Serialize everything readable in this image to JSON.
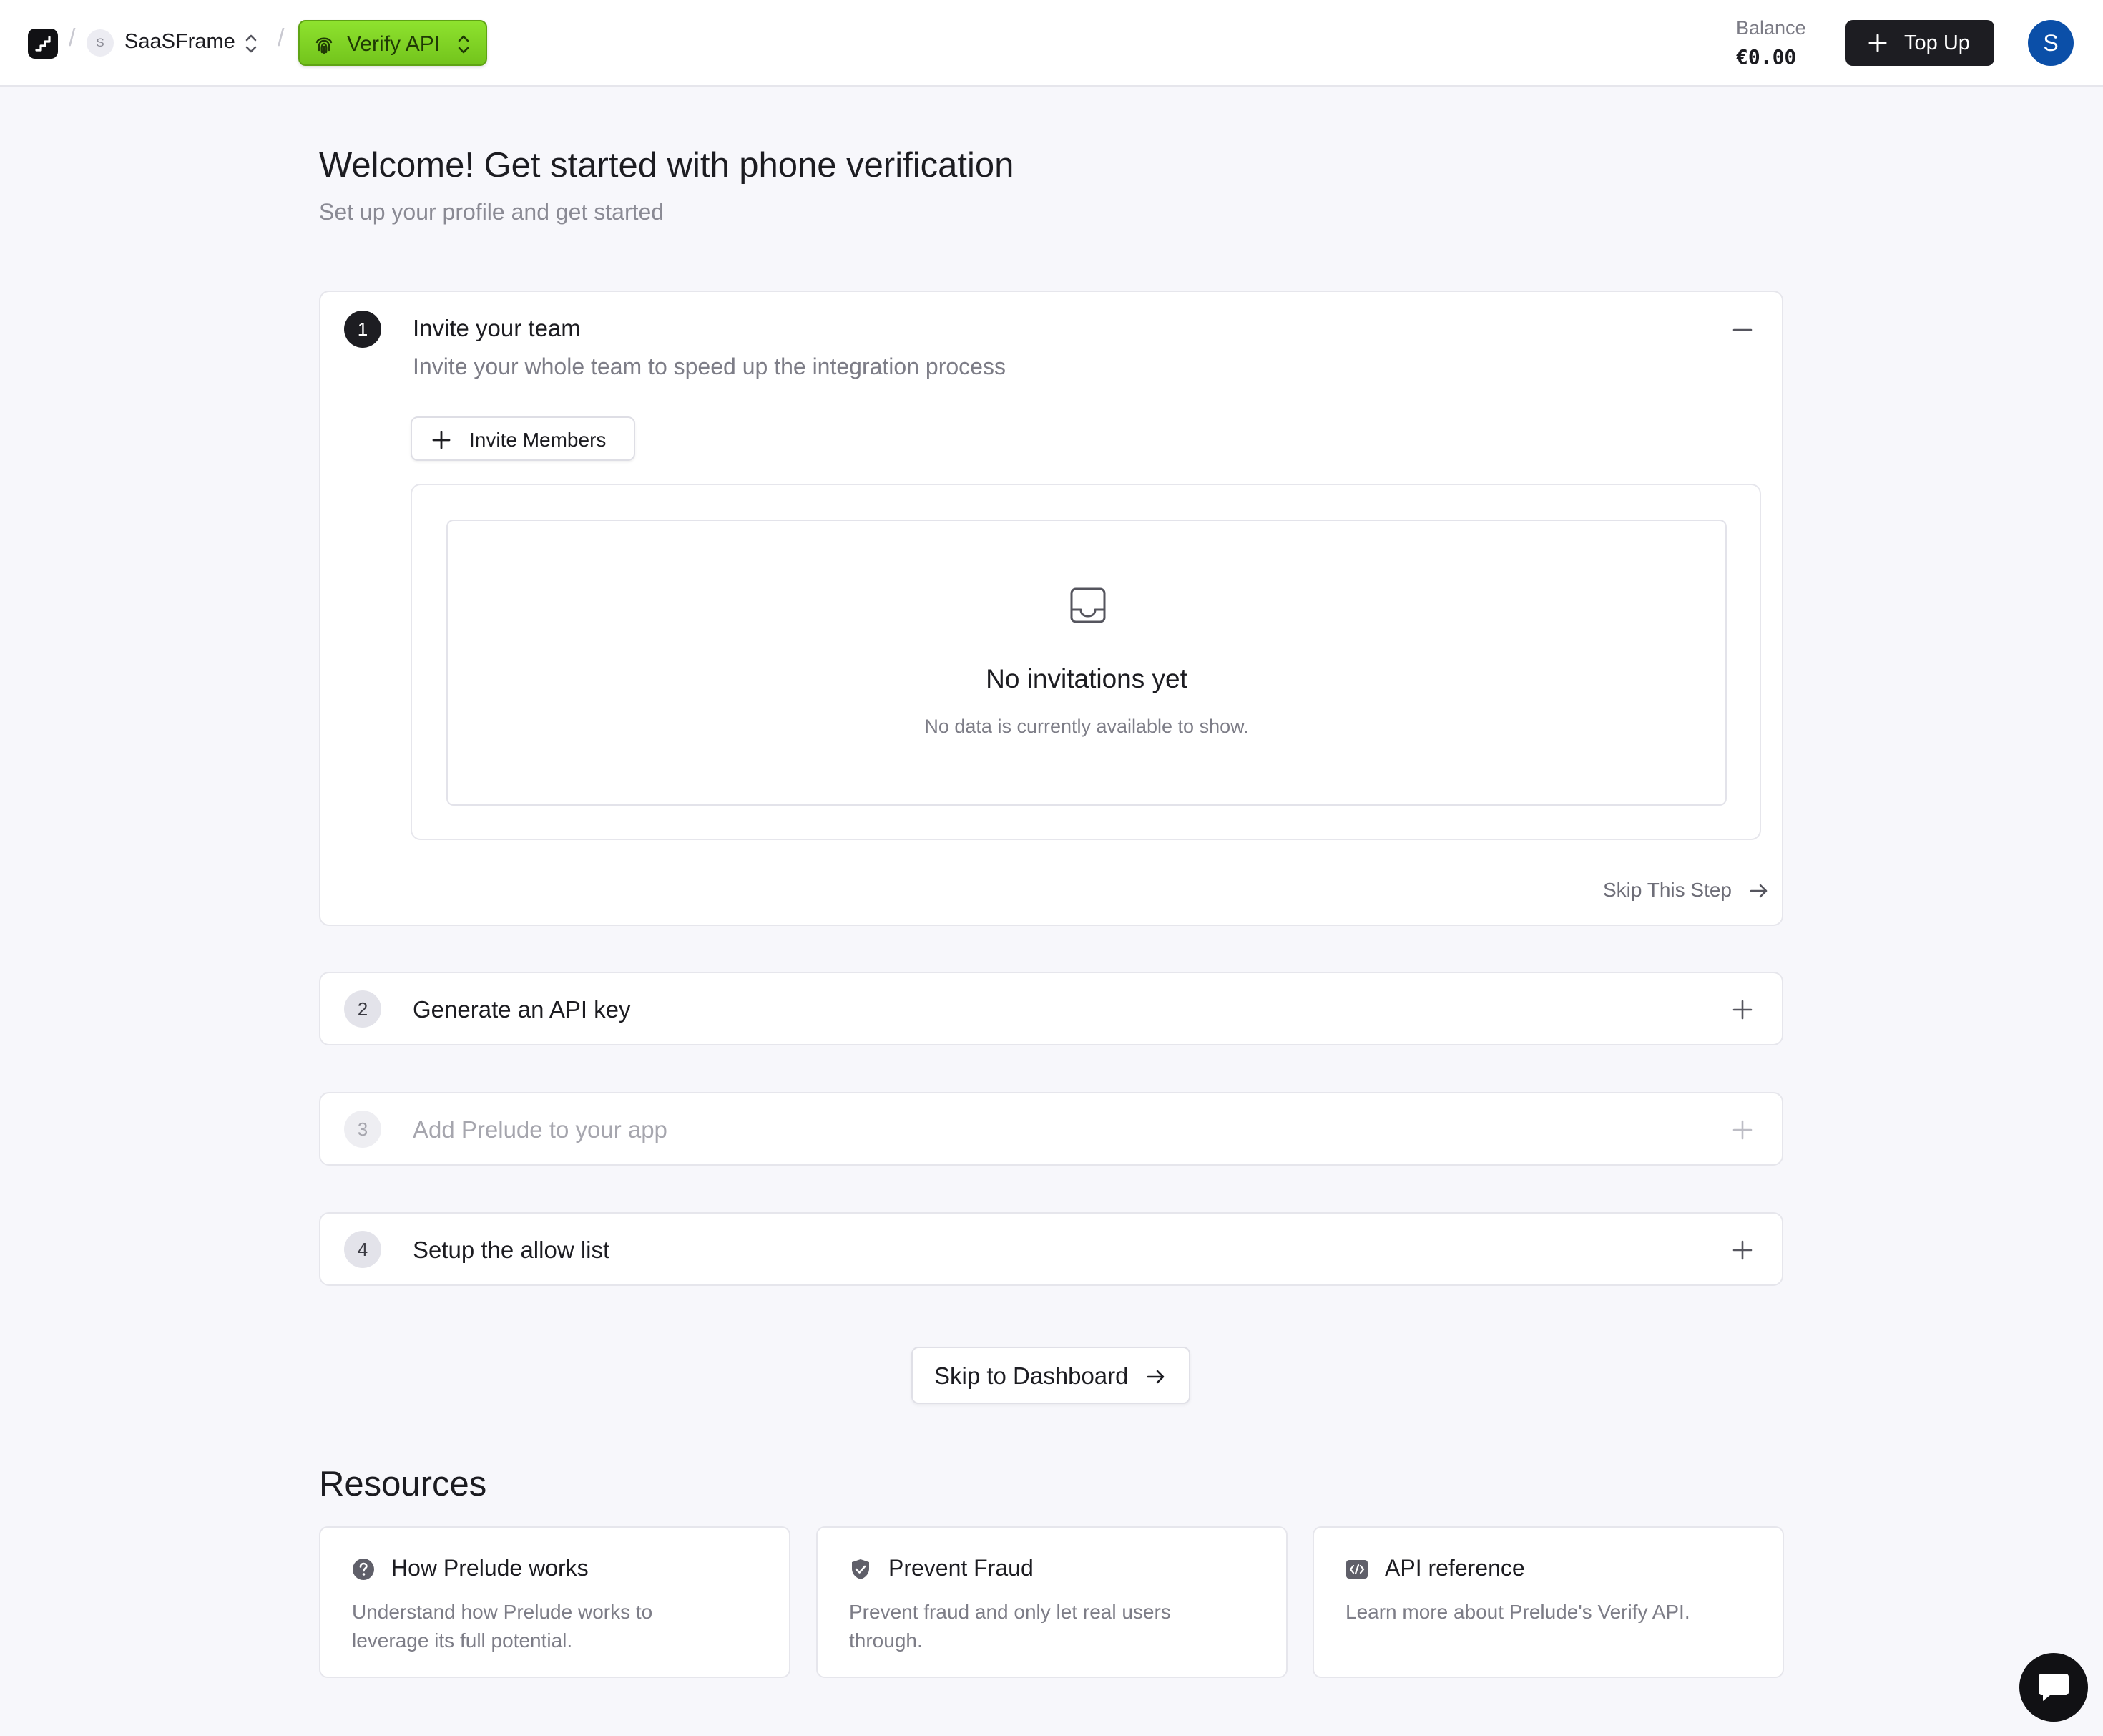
{
  "header": {
    "org_avatar_letter": "S",
    "org_name": "SaaSFrame",
    "product": "Verify API",
    "balance_label": "Balance",
    "balance_value": "€0.00",
    "topup_label": "Top Up",
    "user_initial": "S"
  },
  "colors": {
    "product_pill": "#7fd321",
    "topup_button": "#1d1d22",
    "user_avatar": "#0b4fa8",
    "page_background": "#f7f7fb"
  },
  "page": {
    "title": "Welcome! Get started with phone verification",
    "subtitle": "Set up your profile and get started"
  },
  "steps": [
    {
      "number": "1",
      "title": "Invite your team",
      "description": "Invite your whole team to speed up the integration process",
      "state": "expanded",
      "invite_button": "Invite Members",
      "empty_title": "No invitations yet",
      "empty_subtitle": "No data is currently available to show.",
      "skip_label": "Skip This Step"
    },
    {
      "number": "2",
      "title": "Generate an API key",
      "state": "collapsed"
    },
    {
      "number": "3",
      "title": "Add Prelude to your app",
      "state": "disabled"
    },
    {
      "number": "4",
      "title": "Setup the allow list",
      "state": "collapsed"
    }
  ],
  "skip_dashboard_label": "Skip to Dashboard",
  "resources": {
    "title": "Resources",
    "cards": [
      {
        "icon": "question-circle-icon",
        "title": "How Prelude works",
        "description": "Understand how Prelude works to leverage its full potential."
      },
      {
        "icon": "shield-check-icon",
        "title": "Prevent Fraud",
        "description": "Prevent fraud and only let real users through."
      },
      {
        "icon": "code-icon",
        "title": "API reference",
        "description": "Learn more about Prelude's Verify API."
      }
    ]
  }
}
